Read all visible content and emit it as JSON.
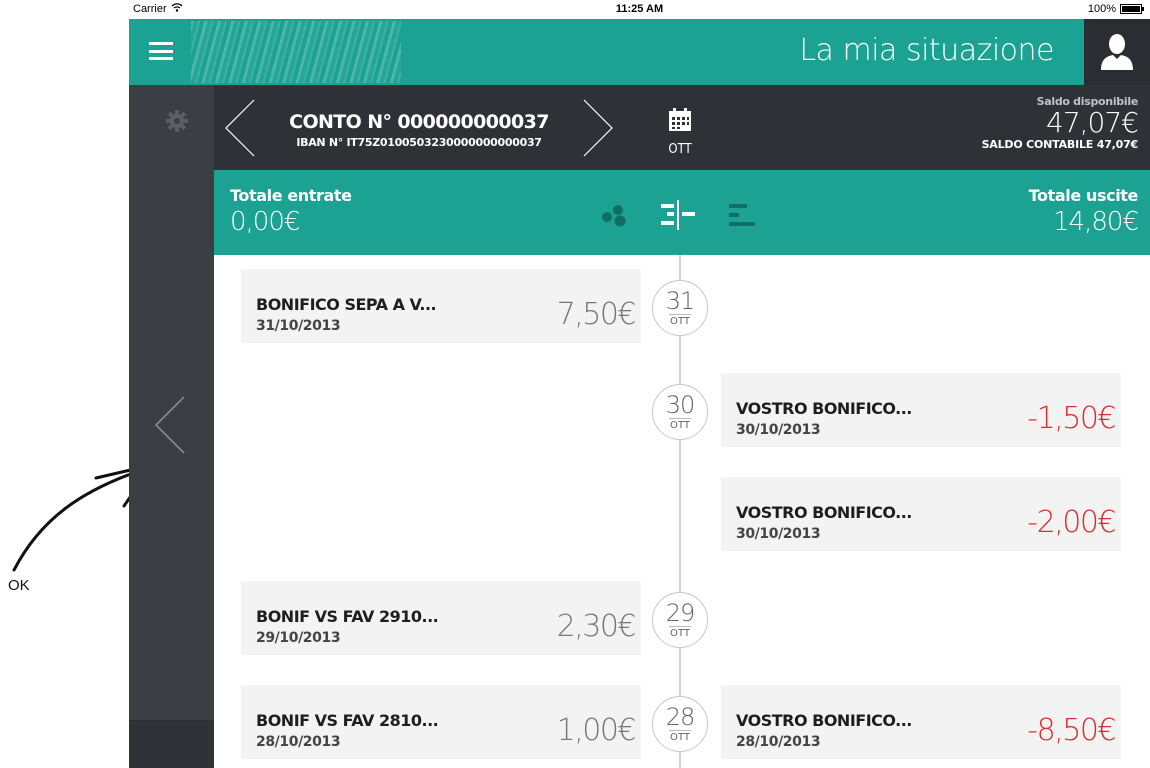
{
  "annotation": {
    "label": "OK"
  },
  "status_bar": {
    "carrier": "Carrier",
    "time": "11:25 AM",
    "battery": "100%"
  },
  "header": {
    "title": "La mia situazione"
  },
  "account": {
    "number": "CONTO N° 000000000037",
    "iban": "IBAN N° IT75Z0100503230000000000037",
    "calendar_label": "OTT",
    "available_label": "Saldo disponibile",
    "available_value": "47,07€",
    "accounting_balance": "SALDO CONTABILE  47,07€"
  },
  "totals": {
    "income_label": "Totale entrate",
    "income_value": "0,00€",
    "expense_label": "Totale uscite",
    "expense_value": "14,80€"
  },
  "transactions": [
    {
      "title": "BONIFICO SEPA A V...",
      "date": "31/10/2013",
      "amount": "7,50€",
      "side": "in"
    },
    {
      "title": "VOSTRO BONIFICO...",
      "date": "30/10/2013",
      "amount": "-1,50€",
      "side": "out"
    },
    {
      "title": "VOSTRO BONIFICO...",
      "date": "30/10/2013",
      "amount": "-2,00€",
      "side": "out"
    },
    {
      "title": "BONIF VS FAV 2910...",
      "date": "29/10/2013",
      "amount": "2,30€",
      "side": "in"
    },
    {
      "title": "BONIF VS FAV 2810...",
      "date": "28/10/2013",
      "amount": "1,00€",
      "side": "in"
    },
    {
      "title": "VOSTRO BONIFICO...",
      "date": "28/10/2013",
      "amount": "-8,50€",
      "side": "out"
    }
  ],
  "date_badges": [
    {
      "day": "31",
      "month": "OTT"
    },
    {
      "day": "30",
      "month": "OTT"
    },
    {
      "day": "29",
      "month": "OTT"
    },
    {
      "day": "28",
      "month": "OTT"
    }
  ],
  "colors": {
    "teal": "#1ba293",
    "dark": "#2e3135",
    "sidebar": "#3b3e42",
    "negative": "#e02b2b"
  }
}
